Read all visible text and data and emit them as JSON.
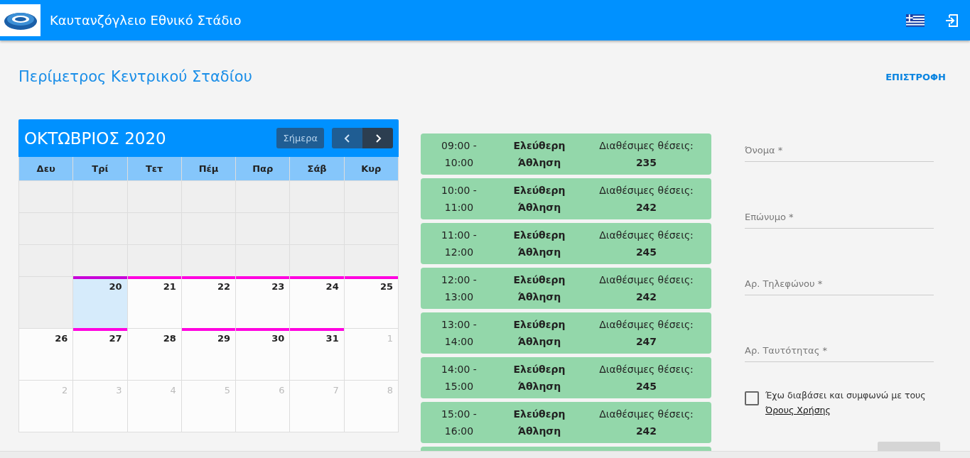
{
  "header": {
    "title": "Καυτανζόγλειο Εθνικό Στάδιο"
  },
  "page": {
    "title": "Περίμετρος Κεντρικού Σταδίου",
    "back": "ΕΠΙΣΤΡΟΦΗ"
  },
  "calendar": {
    "month": "ΟΚΤΩΒΡΙΟΣ 2020",
    "today": "Σήμερα",
    "weekdays": [
      "Δευ",
      "Τρί",
      "Τετ",
      "Πέμ",
      "Παρ",
      "Σάβ",
      "Κυρ"
    ],
    "weeks": [
      [
        {
          "kind": "blank"
        },
        {
          "kind": "blank"
        },
        {
          "kind": "blank"
        },
        {
          "kind": "blank"
        },
        {
          "kind": "blank"
        },
        {
          "kind": "blank"
        },
        {
          "kind": "blank"
        }
      ],
      [
        {
          "kind": "blank"
        },
        {
          "kind": "blank"
        },
        {
          "kind": "blank"
        },
        {
          "kind": "blank"
        },
        {
          "kind": "blank"
        },
        {
          "kind": "blank"
        },
        {
          "kind": "blank"
        }
      ],
      [
        {
          "kind": "blank"
        },
        {
          "kind": "blank"
        },
        {
          "kind": "blank"
        },
        {
          "kind": "blank"
        },
        {
          "kind": "blank"
        },
        {
          "kind": "blank"
        },
        {
          "kind": "blank"
        }
      ],
      [
        {
          "kind": "blank"
        },
        {
          "kind": "day",
          "day": "20",
          "selected": true,
          "event": true
        },
        {
          "kind": "day",
          "day": "21",
          "selected": false,
          "event": true
        },
        {
          "kind": "day",
          "day": "22",
          "selected": false,
          "event": true
        },
        {
          "kind": "day",
          "day": "23",
          "selected": false,
          "event": true
        },
        {
          "kind": "day",
          "day": "24",
          "selected": false,
          "event": true
        },
        {
          "kind": "day",
          "day": "25",
          "selected": false,
          "event": true
        }
      ],
      [
        {
          "kind": "day",
          "day": "26",
          "selected": false,
          "event": false
        },
        {
          "kind": "day",
          "day": "27",
          "selected": false,
          "event": true
        },
        {
          "kind": "day",
          "day": "28",
          "selected": false,
          "event": false
        },
        {
          "kind": "day",
          "day": "29",
          "selected": false,
          "event": true
        },
        {
          "kind": "day",
          "day": "30",
          "selected": false,
          "event": true
        },
        {
          "kind": "day",
          "day": "31",
          "selected": false,
          "event": true
        },
        {
          "kind": "other",
          "day": "1"
        }
      ],
      [
        {
          "kind": "other",
          "day": "2"
        },
        {
          "kind": "other",
          "day": "3"
        },
        {
          "kind": "other",
          "day": "4"
        },
        {
          "kind": "other",
          "day": "5"
        },
        {
          "kind": "other",
          "day": "6"
        },
        {
          "kind": "other",
          "day": "7"
        },
        {
          "kind": "other",
          "day": "8"
        }
      ]
    ]
  },
  "slots": [
    {
      "kind": "slot",
      "start": "09:00 -",
      "end": "10:00",
      "activity": "Ελεύθερη Άθληση",
      "seats_label": "Διαθέσιμες θέσεις:",
      "seats": "235"
    },
    {
      "kind": "slot",
      "start": "10:00 -",
      "end": "11:00",
      "activity": "Ελεύθερη Άθληση",
      "seats_label": "Διαθέσιμες θέσεις:",
      "seats": "242"
    },
    {
      "kind": "slot",
      "start": "11:00 -",
      "end": "12:00",
      "activity": "Ελεύθερη Άθληση",
      "seats_label": "Διαθέσιμες θέσεις:",
      "seats": "245"
    },
    {
      "kind": "slot",
      "start": "12:00 -",
      "end": "13:00",
      "activity": "Ελεύθερη Άθληση",
      "seats_label": "Διαθέσιμες θέσεις:",
      "seats": "242"
    },
    {
      "kind": "slot",
      "start": "13:00 -",
      "end": "14:00",
      "activity": "Ελεύθερη Άθληση",
      "seats_label": "Διαθέσιμες θέσεις:",
      "seats": "247"
    },
    {
      "kind": "slot",
      "start": "14:00 -",
      "end": "15:00",
      "activity": "Ελεύθερη Άθληση",
      "seats_label": "Διαθέσιμες θέσεις:",
      "seats": "245"
    },
    {
      "kind": "slot",
      "start": "15:00 -",
      "end": "16:00",
      "activity": "Ελεύθερη Άθληση",
      "seats_label": "Διαθέσιμες θέσεις:",
      "seats": "242"
    },
    {
      "kind": "cut"
    }
  ],
  "form": {
    "fields": [
      {
        "placeholder": "Όνομα *"
      },
      {
        "placeholder": "Επώνυμο *"
      },
      {
        "placeholder": "Αρ. Τηλεφώνου *"
      },
      {
        "placeholder": "Αρ. Ταυτότητας *"
      }
    ],
    "terms": {
      "checked": false,
      "text": "Έχω διαβάσει και συμφωνώ με τους",
      "link": "Όρους Χρήσης"
    },
    "submit": {
      "disabled": true
    }
  }
}
